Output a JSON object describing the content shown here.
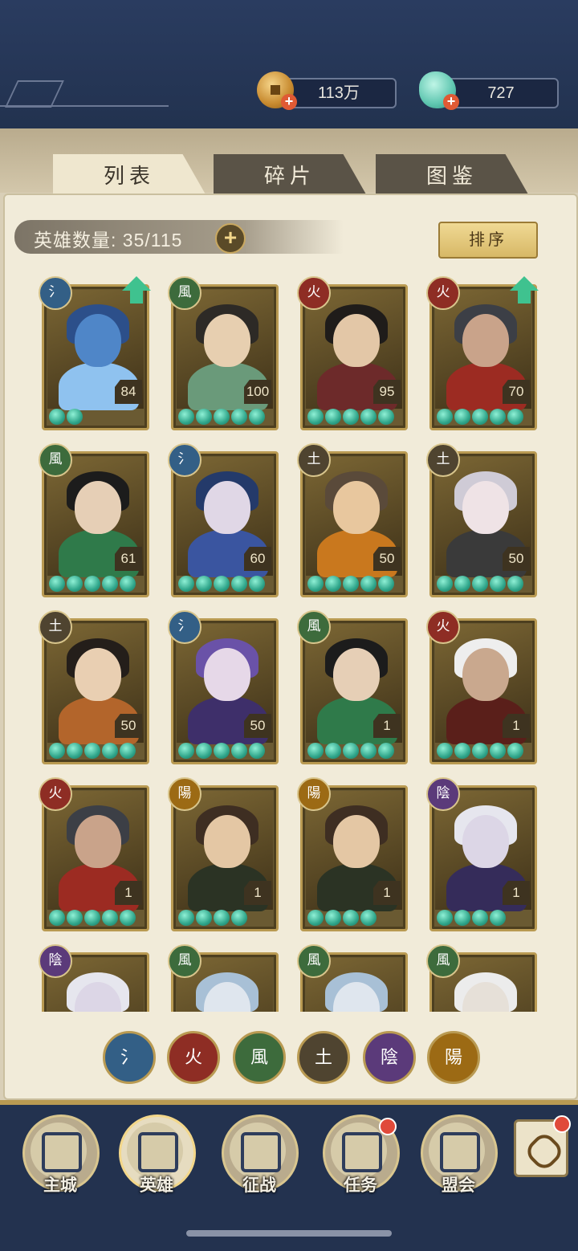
{
  "resources": {
    "coins": "113万",
    "jade": "727"
  },
  "tabs": [
    "列表",
    "碎片",
    "图鉴"
  ],
  "hero_count": "英雄数量: 35/115",
  "sort_label": "排序",
  "elements": {
    "water": "氵",
    "fire": "火",
    "wind": "風",
    "earth": "土",
    "yin": "陰",
    "yang": "陽"
  },
  "heroes": [
    {
      "element": "氵",
      "elem_key": "water",
      "level": "84",
      "stars": 2,
      "upgrade": true
    },
    {
      "element": "風",
      "elem_key": "wind",
      "level": "100",
      "stars": 5,
      "upgrade": false
    },
    {
      "element": "火",
      "elem_key": "fire",
      "level": "95",
      "stars": 5,
      "upgrade": false
    },
    {
      "element": "火",
      "elem_key": "fire",
      "level": "70",
      "stars": 5,
      "upgrade": true
    },
    {
      "element": "風",
      "elem_key": "wind",
      "level": "61",
      "stars": 5,
      "upgrade": false
    },
    {
      "element": "氵",
      "elem_key": "water",
      "level": "60",
      "stars": 5,
      "upgrade": false
    },
    {
      "element": "土",
      "elem_key": "earth",
      "level": "50",
      "stars": 5,
      "upgrade": false
    },
    {
      "element": "土",
      "elem_key": "earth",
      "level": "50",
      "stars": 5,
      "upgrade": false
    },
    {
      "element": "土",
      "elem_key": "earth",
      "level": "50",
      "stars": 5,
      "upgrade": false
    },
    {
      "element": "氵",
      "elem_key": "water",
      "level": "50",
      "stars": 5,
      "upgrade": false
    },
    {
      "element": "風",
      "elem_key": "wind",
      "level": "1",
      "stars": 5,
      "upgrade": false
    },
    {
      "element": "火",
      "elem_key": "fire",
      "level": "1",
      "stars": 5,
      "upgrade": false
    },
    {
      "element": "火",
      "elem_key": "fire",
      "level": "1",
      "stars": 5,
      "upgrade": false
    },
    {
      "element": "陽",
      "elem_key": "yang",
      "level": "1",
      "stars": 4,
      "upgrade": false
    },
    {
      "element": "陽",
      "elem_key": "yang",
      "level": "1",
      "stars": 4,
      "upgrade": false
    },
    {
      "element": "陰",
      "elem_key": "yin",
      "level": "1",
      "stars": 4,
      "upgrade": false
    },
    {
      "element": "陰",
      "elem_key": "yin",
      "level": "",
      "stars": 0,
      "upgrade": false
    },
    {
      "element": "風",
      "elem_key": "wind",
      "level": "",
      "stars": 0,
      "upgrade": false
    },
    {
      "element": "風",
      "elem_key": "wind",
      "level": "",
      "stars": 0,
      "upgrade": false
    },
    {
      "element": "風",
      "elem_key": "wind",
      "level": "",
      "stars": 0,
      "upgrade": false
    }
  ],
  "filters": [
    {
      "key": "water",
      "label": "氵"
    },
    {
      "key": "fire",
      "label": "火"
    },
    {
      "key": "wind",
      "label": "風"
    },
    {
      "key": "earth",
      "label": "土"
    },
    {
      "key": "yin",
      "label": "陰"
    },
    {
      "key": "yang",
      "label": "陽"
    }
  ],
  "nav": [
    {
      "label": "主城",
      "icon": "city-gate-icon",
      "badge": false,
      "active": false
    },
    {
      "label": "英雄",
      "icon": "hero-portrait-icon",
      "badge": false,
      "active": true
    },
    {
      "label": "征战",
      "icon": "battle-icon",
      "badge": false,
      "active": false
    },
    {
      "label": "任务",
      "icon": "task-scroll-icon",
      "badge": true,
      "active": false
    },
    {
      "label": "盟会",
      "icon": "alliance-hall-icon",
      "badge": false,
      "active": false
    }
  ],
  "side_button": {
    "icon": "flower-menu-icon",
    "badge": true
  }
}
